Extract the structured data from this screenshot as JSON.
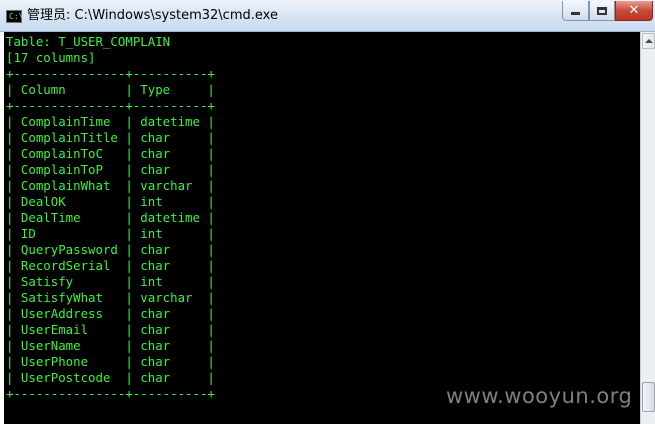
{
  "window": {
    "title": "管理员: C:\\Windows\\system32\\cmd.exe",
    "icon": "cmd-prompt-icon",
    "controls": {
      "minimize": "minimize-icon",
      "maximize": "maximize-icon",
      "close": "✕"
    }
  },
  "console": {
    "lines": [
      "Table: T_USER_COMPLAIN",
      "[17 columns]",
      "+---------------+----------+",
      "| Column        | Type     |",
      "+---------------+----------+",
      "| ComplainTime  | datetime |",
      "| ComplainTitle | char     |",
      "| ComplainToC   | char     |",
      "| ComplainToP   | char     |",
      "| ComplainWhat  | varchar  |",
      "| DealOK        | int      |",
      "| DealTime      | datetime |",
      "| ID            | int      |",
      "| QueryPassword | char     |",
      "| RecordSerial  | char     |",
      "| Satisfy       | int      |",
      "| SatisfyWhat   | varchar  |",
      "| UserAddress   | char     |",
      "| UserEmail     | char     |",
      "| UserName      | char     |",
      "| UserPhone     | char     |",
      "| UserPostcode  | char     |",
      "+---------------+----------+"
    ],
    "text_color": "#3cf23c",
    "background": "#000000"
  },
  "watermark": "www.wooyun.org"
}
